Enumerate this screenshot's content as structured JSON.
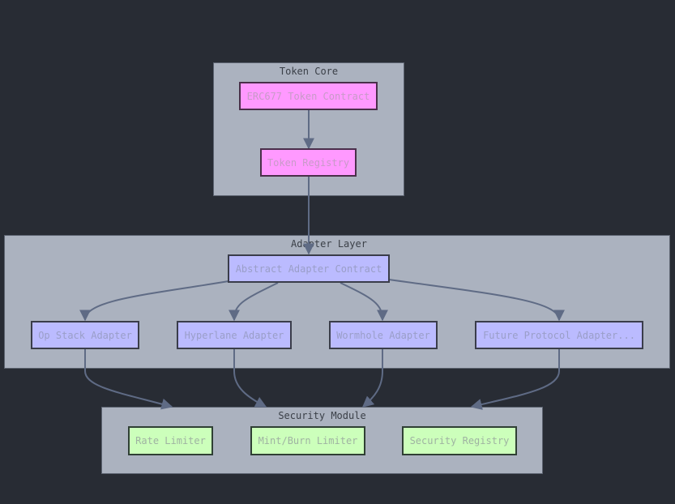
{
  "diagram": {
    "clusters": [
      {
        "id": "token-core",
        "title": "Token Core"
      },
      {
        "id": "adapter-layer",
        "title": "Adapter Layer"
      },
      {
        "id": "security-module",
        "title": "Security Module"
      }
    ],
    "nodes": {
      "erc677": "ERC677 Token Contract",
      "token_registry": "Token Registry",
      "abstract_adapter": "Abstract Adapter Contract",
      "op_stack": "Op Stack Adapter",
      "hyperlane": "Hyperlane Adapter",
      "wormhole": "Wormhole Adapter",
      "future_protocol": "Future Protocol Adapter...",
      "rate_limiter": "Rate Limiter",
      "mint_burn_limiter": "Mint/Burn Limiter",
      "security_registry": "Security Registry"
    },
    "edges": [
      {
        "from": "ERC677 Token Contract",
        "to": "Token Registry"
      },
      {
        "from": "Token Registry",
        "to": "Abstract Adapter Contract"
      },
      {
        "from": "Abstract Adapter Contract",
        "to": "Op Stack Adapter"
      },
      {
        "from": "Abstract Adapter Contract",
        "to": "Hyperlane Adapter"
      },
      {
        "from": "Abstract Adapter Contract",
        "to": "Wormhole Adapter"
      },
      {
        "from": "Abstract Adapter Contract",
        "to": "Future Protocol Adapter..."
      },
      {
        "from": "Op Stack Adapter",
        "to": "Security Module"
      },
      {
        "from": "Hyperlane Adapter",
        "to": "Security Module"
      },
      {
        "from": "Wormhole Adapter",
        "to": "Security Module"
      },
      {
        "from": "Future Protocol Adapter...",
        "to": "Security Module"
      }
    ],
    "colors": {
      "background": "#282c34",
      "cluster_fill": "#abb2bf",
      "core_node_fill": "#ff99ff",
      "adapter_node_fill": "#bbbbff",
      "security_node_fill": "#ccffbb",
      "edge": "#5f6b85"
    }
  }
}
